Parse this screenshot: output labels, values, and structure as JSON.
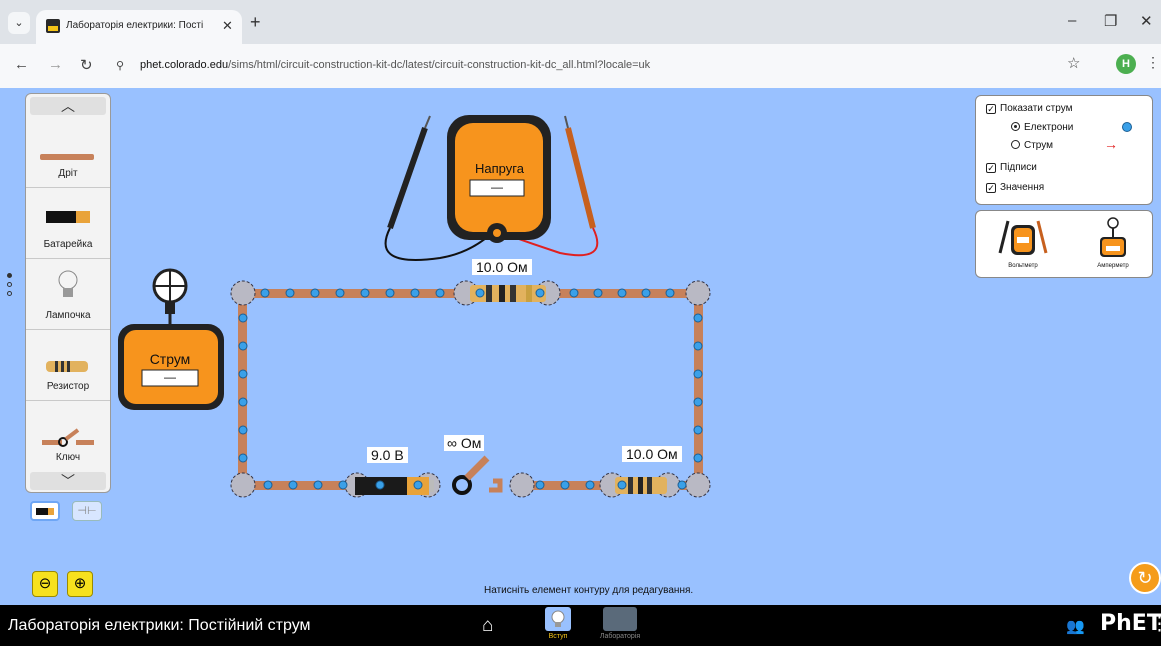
{
  "browser": {
    "tab_title": "Лабораторія електрики: Пості",
    "new_tab": "+",
    "url_host": "phet.colorado.edu",
    "url_path": "/sims/html/circuit-construction-kit-dc/latest/circuit-construction-kit-dc_all.html?locale=uk",
    "profile_initial": "H"
  },
  "toolbox": {
    "items": [
      {
        "label": "Дріт",
        "icon": "wire-icon"
      },
      {
        "label": "Батарейка",
        "icon": "battery-icon"
      },
      {
        "label": "Лампочка",
        "icon": "lightbulb-icon"
      },
      {
        "label": "Резистор",
        "icon": "resistor-icon"
      },
      {
        "label": "Ключ",
        "icon": "switch-icon"
      }
    ]
  },
  "circuit": {
    "top_resistor_label": "10.0 Ом",
    "right_resistor_label": "10.0 Ом",
    "battery_label": "9.0 В",
    "switch_label": "∞ Ом"
  },
  "voltmeter": {
    "title": "Напруга",
    "readout": "—"
  },
  "ammeter": {
    "title": "Струм",
    "readout": "—"
  },
  "display_panel": {
    "show_current": "Показати струм",
    "electrons": "Електрони",
    "conventional": "Струм",
    "labels": "Підписи",
    "values": "Значення",
    "selected_mode": "electrons"
  },
  "sensor_panel": {
    "voltmeter": "Вольтметр",
    "ammeter": "Амперметр"
  },
  "hint": "Натисніть елемент контуру для редагування.",
  "nav": {
    "sim_title": "Лабораторія електрики: Постійний струм",
    "screen_intro": "Вступ",
    "screen_lab": "Лабораторія",
    "brand": "PhET"
  },
  "colors": {
    "sim_bg": "#99c1ff",
    "accent": "#f5c518",
    "meter_orange": "#f7941d",
    "wire_copper": "#c7815a",
    "electron": "#3aa0e8"
  }
}
